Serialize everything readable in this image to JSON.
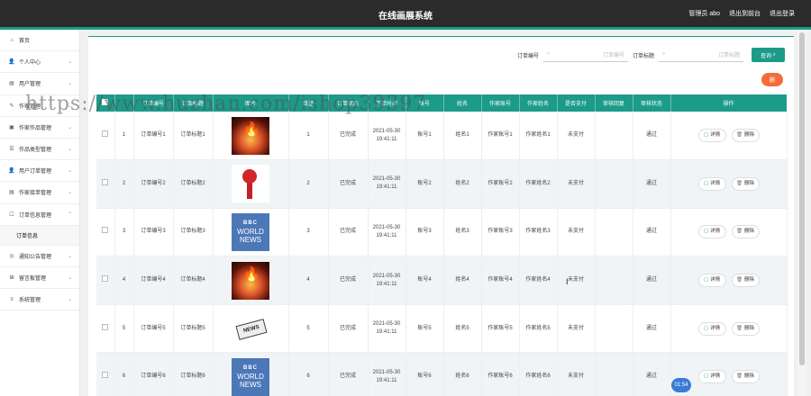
{
  "header": {
    "title": "在线画展系统",
    "links": [
      "管理员 abo",
      "退出到前台",
      "退出登录"
    ]
  },
  "sidebar": {
    "items": [
      {
        "label": "首页",
        "icon": "home-icon",
        "glyph": "⌂",
        "chevron": false
      },
      {
        "label": "个人中心",
        "icon": "user-icon",
        "glyph": "👤",
        "chevron": true
      },
      {
        "label": "用户管理",
        "icon": "users-icon",
        "glyph": "▤",
        "chevron": true
      },
      {
        "label": "作家管理",
        "icon": "pen-icon",
        "glyph": "✎",
        "chevron": true
      },
      {
        "label": "作家作品管理",
        "icon": "picture-icon",
        "glyph": "▣",
        "chevron": true
      },
      {
        "label": "作品类型管理",
        "icon": "tag-icon",
        "glyph": "☰",
        "chevron": true
      },
      {
        "label": "用户订单管理",
        "icon": "person-order-icon",
        "glyph": "👤",
        "chevron": true
      },
      {
        "label": "作家接单管理",
        "icon": "order-icon",
        "glyph": "▤",
        "chevron": true
      },
      {
        "label": "订单信息管理",
        "icon": "info-icon",
        "glyph": "☐",
        "chevron": true,
        "expanded": true,
        "sub": "订单信息"
      },
      {
        "label": "通知公告管理",
        "icon": "bell-icon",
        "glyph": "◎",
        "chevron": true
      },
      {
        "label": "留言板管理",
        "icon": "grid-icon",
        "glyph": "⊞",
        "chevron": true
      },
      {
        "label": "系统管理",
        "icon": "settings-icon",
        "glyph": "≡",
        "chevron": true
      }
    ]
  },
  "search": {
    "order_no_label": "订单编号",
    "order_no_placeholder": "订单编号",
    "order_title_label": "订单标题",
    "order_title_placeholder": "订单标题",
    "query_label": "查询",
    "delete_label": "删"
  },
  "table": {
    "headers": [
      "",
      "",
      "订单编号",
      "订单标题",
      "图片",
      "数量",
      "订单状态",
      "下单时间",
      "账号",
      "姓名",
      "作家账号",
      "作家姓名",
      "是否支付",
      "审核回复",
      "审核状态",
      "操作"
    ],
    "rows": [
      {
        "idx": "1",
        "order_no": "订单编号1",
        "title": "订单标题1",
        "img": "fire",
        "qty": "1",
        "status": "已完成",
        "date": "2021-05-30",
        "time": "19:41:11",
        "account": "账号1",
        "name": "姓名1",
        "wacc": "作家账号1",
        "wname": "作家姓名1",
        "paid": "未支付",
        "reply": "",
        "audit": "通过"
      },
      {
        "idx": "2",
        "order_no": "订单编号2",
        "title": "订单标题2",
        "img": "mic",
        "qty": "2",
        "status": "已完成",
        "date": "2021-05-30",
        "time": "19:41:11",
        "account": "账号2",
        "name": "姓名2",
        "wacc": "作家账号2",
        "wname": "作家姓名2",
        "paid": "未支付",
        "reply": "",
        "audit": "通过"
      },
      {
        "idx": "3",
        "order_no": "订单编号3",
        "title": "订单标题3",
        "img": "bbc",
        "qty": "3",
        "status": "已完成",
        "date": "2021-05-30",
        "time": "19:41:11",
        "account": "账号3",
        "name": "姓名3",
        "wacc": "作家账号3",
        "wname": "作家姓名3",
        "paid": "未支付",
        "reply": "",
        "audit": "通过"
      },
      {
        "idx": "4",
        "order_no": "订单编号4",
        "title": "订单标题4",
        "img": "fire",
        "qty": "4",
        "status": "已完成",
        "date": "2021-05-30",
        "time": "19:41:11",
        "account": "账号4",
        "name": "姓名4",
        "wacc": "作家账号4",
        "wname": "作家姓名4",
        "paid": "未支付",
        "reply": "",
        "audit": "通过"
      },
      {
        "idx": "5",
        "order_no": "订单编号5",
        "title": "订单标题5",
        "img": "news",
        "qty": "5",
        "status": "已完成",
        "date": "2021-05-30",
        "time": "19:41:11",
        "account": "账号5",
        "name": "姓名5",
        "wacc": "作家账号5",
        "wname": "作家姓名5",
        "paid": "未支付",
        "reply": "",
        "audit": "通过"
      },
      {
        "idx": "6",
        "order_no": "订单编号6",
        "title": "订单标题6",
        "img": "bbc",
        "qty": "6",
        "status": "已完成",
        "date": "2021-05-30",
        "time": "19:41:11",
        "account": "账号6",
        "name": "姓名6",
        "wacc": "作家账号6",
        "wname": "作家姓名6",
        "paid": "未支付",
        "reply": "",
        "audit": "通过"
      }
    ],
    "detail_label": "详情",
    "delete_label": "删除"
  },
  "bbc": {
    "line1": "BBC",
    "line2": "WORLD",
    "line3": "NEWS"
  },
  "watermark": "https://www.huzhan.com/ishop39397",
  "float_timer": "01:54",
  "colors": {
    "accent": "#1c9b8a",
    "topbar": "#2b2b2b",
    "danger": "#f56c3c"
  }
}
